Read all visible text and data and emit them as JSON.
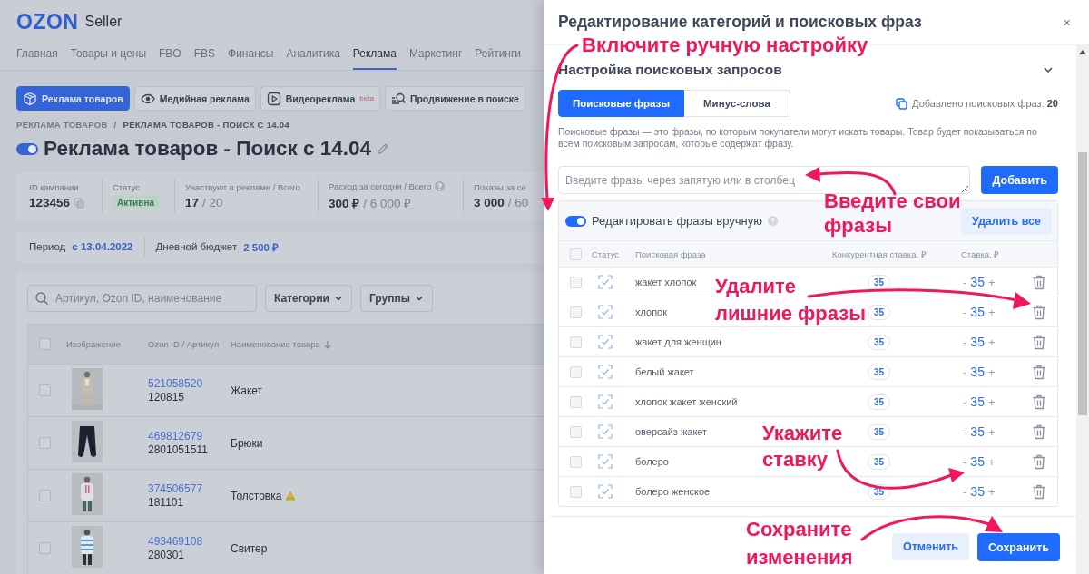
{
  "header": {
    "logo": "OZON",
    "product": "Seller"
  },
  "nav": [
    {
      "label": "Главная",
      "selected": false
    },
    {
      "label": "Товары и цены",
      "selected": false
    },
    {
      "label": "FBO",
      "selected": false
    },
    {
      "label": "FBS",
      "selected": false
    },
    {
      "label": "Финансы",
      "selected": false
    },
    {
      "label": "Аналитика",
      "selected": false
    },
    {
      "label": "Реклама",
      "selected": true
    },
    {
      "label": "Маркетинг",
      "selected": false
    },
    {
      "label": "Рейтинги",
      "selected": false
    }
  ],
  "ad_types": [
    {
      "label": "Реклама товаров",
      "selected": true
    },
    {
      "label": "Медийная реклама",
      "selected": false
    },
    {
      "label": "Видеореклама",
      "badge": "beta",
      "selected": false
    },
    {
      "label": "Продвижение в поиске",
      "selected": false
    }
  ],
  "breadcrumbs": {
    "items": [
      "РЕКЛАМА ТОВАРОВ",
      "РЕКЛАМА ТОВАРОВ - ПОИСК С 14.04"
    ],
    "separator": "/"
  },
  "campaign": {
    "title": "Реклама товаров - Поиск с 14.04",
    "active": true
  },
  "stats": [
    {
      "kind": "id",
      "label": "ID кампании",
      "value": "123456",
      "help": false
    },
    {
      "kind": "status",
      "label": "Статус",
      "value": "Активна",
      "help": false
    },
    {
      "kind": "ratio",
      "label": "Участвуют в рекламе / Всего",
      "value": "17",
      "total": "/ 20",
      "help": false
    },
    {
      "kind": "ratio",
      "label": "Расход за сегодня / Всего",
      "value": "300 ₽",
      "total": "/ 6 000 ₽",
      "help": true
    },
    {
      "kind": "ratio",
      "label": "Показы за се",
      "value": "3 000",
      "total": "/ 60",
      "help": false
    }
  ],
  "period": {
    "label": "Период",
    "value": "с 13.04.2022"
  },
  "budget": {
    "label": "Дневной бюджет",
    "value": "2 500 ₽"
  },
  "products": {
    "search_placeholder": "Артикул, Ozon ID, наименование",
    "filters": [
      "Категории",
      "Группы"
    ],
    "all_checked": false,
    "columns": [
      "Изображение",
      "Ozon ID / Артикул",
      "Наименование товара"
    ],
    "rows": [
      {
        "ozon_id": "521058520",
        "article": "120815",
        "name": "Жакет",
        "warning": false,
        "checked": false
      },
      {
        "ozon_id": "469812679",
        "article": "2801051511",
        "name": "Брюки",
        "warning": false,
        "checked": false
      },
      {
        "ozon_id": "374506577",
        "article": "181101",
        "name": "Толстовка",
        "warning": true,
        "checked": false
      },
      {
        "ozon_id": "493469108",
        "article": "280301",
        "name": "Свитер",
        "warning": false,
        "checked": false
      }
    ]
  },
  "drawer": {
    "title": "Редактирование категорий и поисковых фраз",
    "close": "×",
    "section": "Настройка поисковых запросов",
    "tabs": [
      {
        "label": "Поисковые фразы",
        "selected": true
      },
      {
        "label": "Минус-слова",
        "selected": false
      }
    ],
    "added_count": "Добавлено поисковых фраз: **20**",
    "description": "Поисковые фразы — это фразы, по которым покупатели могут искать товары. Товар будет показываться по всем поисковым запросам, которые содержат фразу.",
    "phrase_input": {
      "placeholder": "Введите фразы через запятую или в столбец"
    },
    "add_button": "Добавить",
    "manual_edit": {
      "label": "Редактировать фразы вручную",
      "on": true
    },
    "delete_all": "Удалить все",
    "all_checked": false,
    "columns": [
      "Статус",
      "Поисковая фраза",
      "Конкурентная ставка, ₽",
      "Ставка, ₽"
    ],
    "phrases": [
      {
        "phrase": "жакет хлопок",
        "competitor_bid": "35",
        "minus": "-",
        "bid": "35",
        "plus": "+",
        "checked": false
      },
      {
        "phrase": "хлопок",
        "competitor_bid": "35",
        "minus": "-",
        "bid": "35",
        "plus": "+",
        "checked": false
      },
      {
        "phrase": "жакет для женщин",
        "competitor_bid": "35",
        "minus": "-",
        "bid": "35",
        "plus": "+",
        "checked": false
      },
      {
        "phrase": "белый жакет",
        "competitor_bid": "35",
        "minus": "-",
        "bid": "35",
        "plus": "+",
        "checked": false
      },
      {
        "phrase": "хлопок жакет женский",
        "competitor_bid": "35",
        "minus": "-",
        "bid": "35",
        "plus": "+",
        "checked": false
      },
      {
        "phrase": "оверсайз жакет",
        "competitor_bid": "35",
        "minus": "-",
        "bid": "35",
        "plus": "+",
        "checked": false
      },
      {
        "phrase": "болеро",
        "competitor_bid": "35",
        "minus": "-",
        "bid": "35",
        "plus": "+",
        "checked": false
      },
      {
        "phrase": "болеро женское",
        "competitor_bid": "35",
        "minus": "-",
        "bid": "35",
        "plus": "+",
        "checked": false
      }
    ],
    "cancel_button": "Отменить",
    "save_button": "Сохранить"
  },
  "annotations": [
    {
      "text": "Включите ручную настройку"
    },
    {
      "text": "Введите свои\nфразы"
    },
    {
      "text": "Удалите\nлишние фразы"
    },
    {
      "text": "Укажите\nставку"
    },
    {
      "text": "Сохраните\nизменения"
    }
  ]
}
